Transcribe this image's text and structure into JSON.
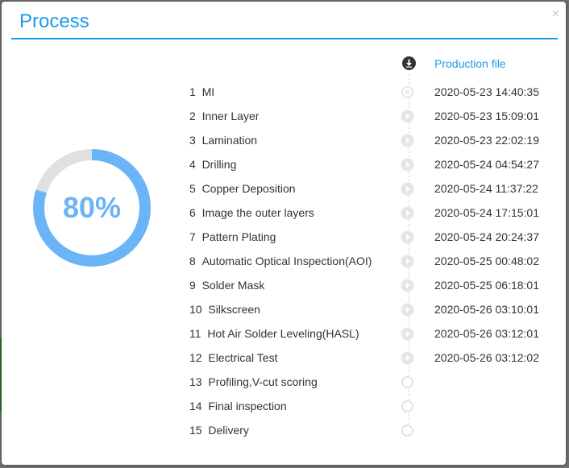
{
  "modal": {
    "title": "Process",
    "close_symbol": "×"
  },
  "progress": {
    "percent": 80,
    "label": "80%",
    "color": "#6ab4f7",
    "track_color": "#e0e0e0"
  },
  "column_header": {
    "label": "Production file",
    "icon": "download-circle-icon"
  },
  "colors": {
    "accent": "#1a9be8",
    "icon_done": "#e6e6e6",
    "icon_pending": "#d9d9d9"
  },
  "steps": [
    {
      "number": "1",
      "name": "MI",
      "time": "2020-05-23 14:40:35",
      "status": "current"
    },
    {
      "number": "2",
      "name": "Inner Layer",
      "time": "2020-05-23 15:09:01",
      "status": "done"
    },
    {
      "number": "3",
      "name": "Lamination",
      "time": "2020-05-23 22:02:19",
      "status": "done"
    },
    {
      "number": "4",
      "name": "Drilling",
      "time": "2020-05-24 04:54:27",
      "status": "done"
    },
    {
      "number": "5",
      "name": "Copper Deposition",
      "time": "2020-05-24 11:37:22",
      "status": "done"
    },
    {
      "number": "6",
      "name": "Image the outer layers",
      "time": "2020-05-24 17:15:01",
      "status": "done"
    },
    {
      "number": "7",
      "name": "Pattern Plating",
      "time": "2020-05-24 20:24:37",
      "status": "done"
    },
    {
      "number": "8",
      "name": "Automatic Optical Inspection(AOI)",
      "time": "2020-05-25 00:48:02",
      "status": "done"
    },
    {
      "number": "9",
      "name": "Solder Mask",
      "time": "2020-05-25 06:18:01",
      "status": "done"
    },
    {
      "number": "10",
      "name": "Silkscreen",
      "time": "2020-05-26 03:10:01",
      "status": "done"
    },
    {
      "number": "11",
      "name": "Hot Air Solder Leveling(HASL)",
      "time": "2020-05-26 03:12:01",
      "status": "done"
    },
    {
      "number": "12",
      "name": "Electrical Test",
      "time": "2020-05-26 03:12:02",
      "status": "done"
    },
    {
      "number": "13",
      "name": "Profiling,V-cut scoring",
      "time": "",
      "status": "pending"
    },
    {
      "number": "14",
      "name": "Final inspection",
      "time": "",
      "status": "pending"
    },
    {
      "number": "15",
      "name": "Delivery",
      "time": "",
      "status": "pending"
    }
  ]
}
